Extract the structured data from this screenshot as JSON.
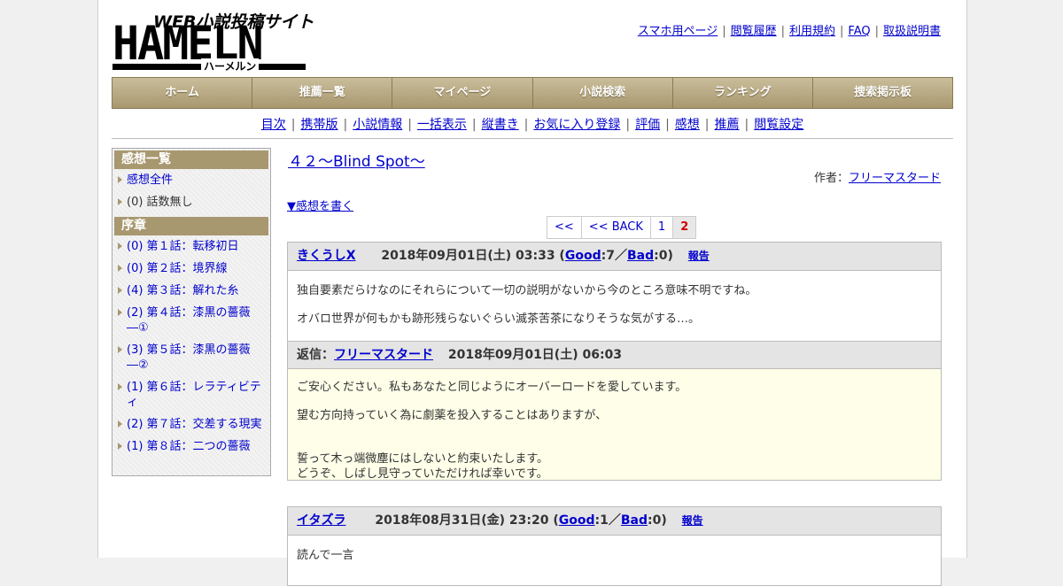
{
  "logo": {
    "tagline": "WEB小説投稿サイト",
    "wordmark": "HAMELN",
    "kana": "ハーメルン"
  },
  "top_links": [
    "スマホ用ページ",
    "閲覧履歴",
    "利用規約",
    "FAQ",
    "取扱説明書"
  ],
  "main_nav": [
    "ホーム",
    "推薦一覧",
    "マイページ",
    "小説検索",
    "ランキング",
    "捜索掲示板"
  ],
  "sub_nav": [
    "目次",
    "携帯版",
    "小説情報",
    "一括表示",
    "縦書き",
    "お気に入り登録",
    "評価",
    "感想",
    "推薦",
    "閲覧設定"
  ],
  "sidebar": {
    "review_heading": "感想一覧",
    "review_items": [
      {
        "label": "感想全件",
        "link": true
      },
      {
        "label": "(0) 話数無し",
        "link": false
      }
    ],
    "chapter_heading": "序章",
    "chapter_items": [
      "(0) 第１話：転移初日",
      "(0) 第２話：境界線",
      "(4) 第３話：解れた糸",
      "(2) 第４話：漆黒の薔薇―①",
      "(3) 第５話：漆黒の薔薇―②",
      "(1) 第６話：レラティビティ",
      "(2) 第７話：交差する現実",
      "(1) 第８話：二つの薔薇"
    ]
  },
  "content": {
    "title": "４２～Blind Spot～",
    "author_label": "作者：",
    "author_name": "フリーマスタード",
    "write_review": "▼感想を書く",
    "pager": [
      "<<",
      "<< BACK",
      "1",
      "2"
    ],
    "pager_current": "2"
  },
  "reviews": [
    {
      "name": "きくうしX",
      "date": "2018年09月01日(土) 03:33",
      "good_label": "Good",
      "good": "7",
      "bad_label": "Bad",
      "bad": "0",
      "report": "報告",
      "lines": [
        "独自要素だらけなのにそれらについて一切の説明がないから今のところ意味不明ですね。",
        "オバロ世界が何もかも跡形残らないぐらい滅茶苦茶になりそうな気がする…。"
      ],
      "reply": {
        "label": "返信：",
        "name": "フリーマスタード",
        "date": "2018年09月01日(土) 06:03",
        "lines": [
          "ご安心ください。私もあなたと同じようにオーバーロードを愛しています。",
          "望む方向持っていく為に劇薬を投入することはありますが、",
          "誓って木っ端微塵にはしないと約束いたします。",
          "どうぞ、しばし見守っていただければ幸いです。"
        ]
      }
    },
    {
      "name": "イタズラ",
      "date": "2018年08月31日(金) 23:20",
      "good_label": "Good",
      "good": "1",
      "bad_label": "Bad",
      "bad": "0",
      "report": "報告",
      "lines": [
        "読んで一言"
      ]
    }
  ]
}
